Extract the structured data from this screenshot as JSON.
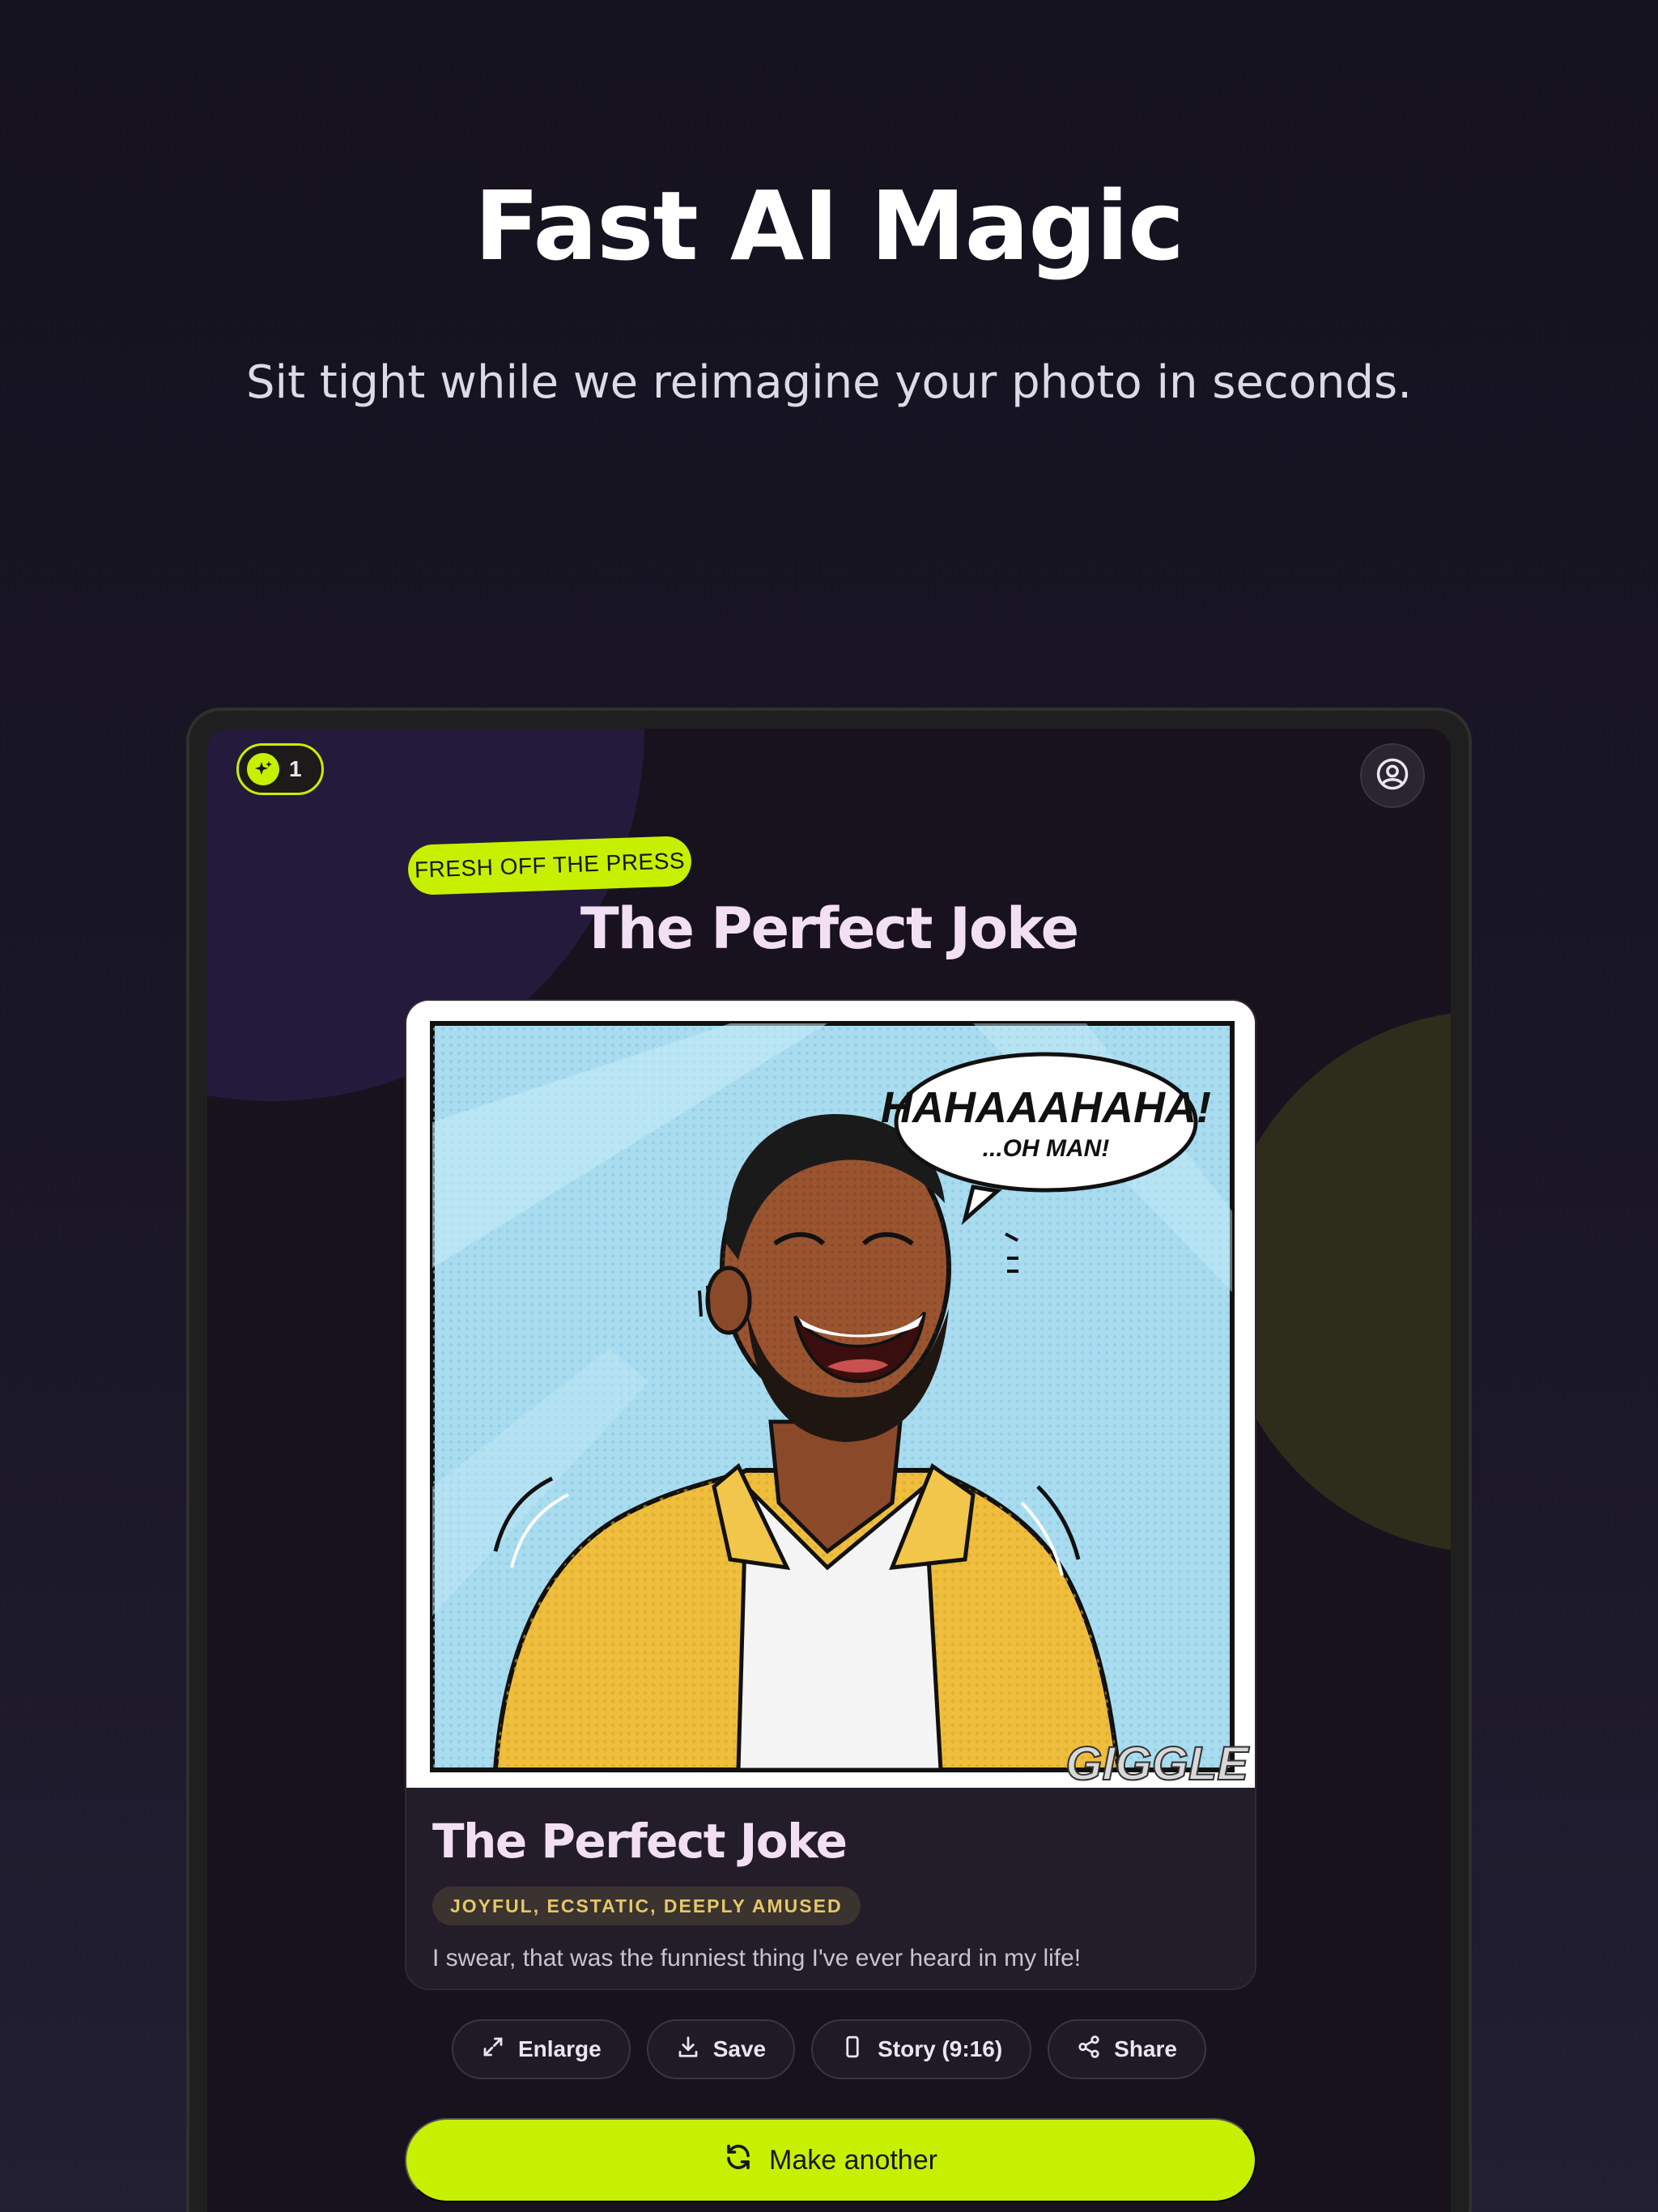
{
  "hero": {
    "title": "Fast AI Magic",
    "subtitle": "Sit tight while we reimagine your photo in seconds."
  },
  "app": {
    "credits": "1",
    "ribbon": "FRESH OFF THE PRESS",
    "result_title": "The Perfect Joke",
    "card": {
      "speech_main": "HAHAAAHAHA!",
      "speech_sub": "...OH MAN!",
      "sound_effect": "GIGGLE",
      "title": "The Perfect Joke",
      "moods": "JOYFUL, ECSTATIC, DEEPLY AMUSED",
      "quote": "I swear, that was the funniest thing I've ever heard in my life!"
    },
    "actions": {
      "enlarge": "Enlarge",
      "save": "Save",
      "story": "Story (9:16)",
      "share": "Share"
    },
    "primary_action": "Make another"
  },
  "colors": {
    "accent": "#c6f000",
    "title_pink": "#f3dff3",
    "mood_gold": "#e7c765"
  },
  "icons": [
    "sparkle-icon",
    "user-circle-icon",
    "expand-icon",
    "download-icon",
    "phone-icon",
    "share-icon",
    "refresh-icon"
  ]
}
